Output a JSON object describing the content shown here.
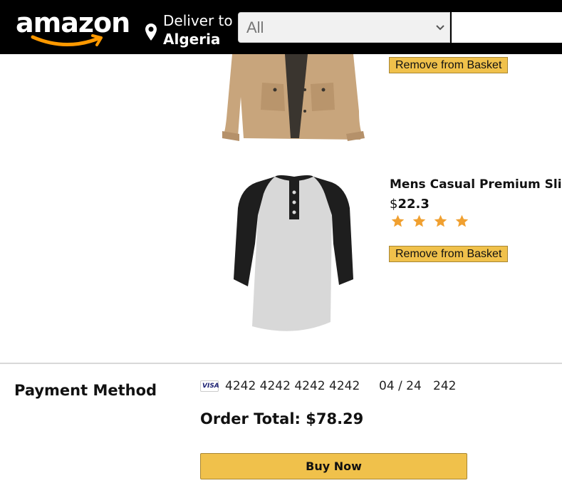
{
  "header": {
    "logo_text": "amazon",
    "deliver_label": "Deliver to",
    "deliver_country": "Algeria",
    "search_category": "All",
    "search_value": "",
    "colors": {
      "background": "#000000",
      "logo_smile": "#f90"
    }
  },
  "basket": {
    "items": [
      {
        "image": "khaki-jacket",
        "remove_label": "Remove from Basket"
      },
      {
        "image": "raglan-henley-shirt",
        "title": "Mens Casual Premium Slim Fit T-Shirts",
        "currency": "$",
        "price": "22.3",
        "rating": 4,
        "remove_label": "Remove from Basket"
      }
    ]
  },
  "payment": {
    "title": "Payment Method",
    "card_brand": "VISA",
    "card_number": "4242 4242 4242 4242",
    "card_expiry": "04 / 24",
    "card_cvc": "242",
    "order_total": "Order Total: $78.29",
    "buy_label": "Buy Now"
  },
  "colors": {
    "button": "#f0c14b",
    "button_border": "#a88734",
    "star": "#f0a030"
  }
}
